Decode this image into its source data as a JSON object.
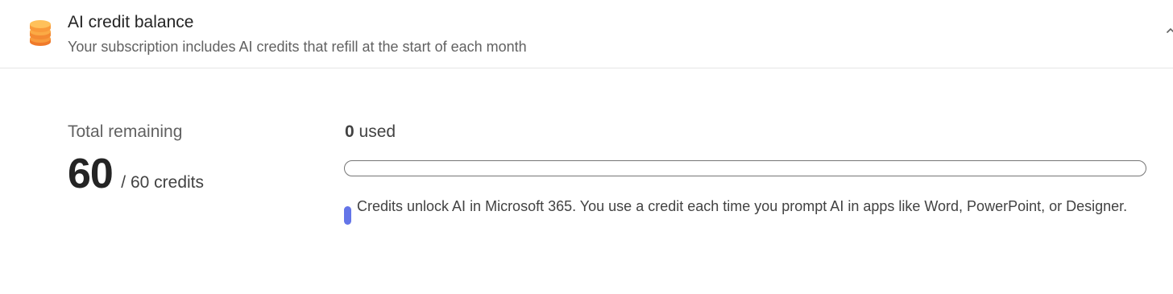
{
  "header": {
    "icon": "coins-stack-icon",
    "title": "AI credit balance",
    "subtitle": "Your subscription includes AI credits that refill at the start of each month",
    "collapse_icon": "chevron-up-icon"
  },
  "balance": {
    "remaining_label": "Total remaining",
    "remaining_value": "60",
    "total_text": "/ 60 credits"
  },
  "usage": {
    "used_count": "0",
    "used_suffix": "used",
    "progress_fraction": 0,
    "accent_color": "#6475e8",
    "info_text": "Credits unlock AI in Microsoft 365. You use a credit each time you prompt AI in apps like Word, PowerPoint, or Designer."
  }
}
